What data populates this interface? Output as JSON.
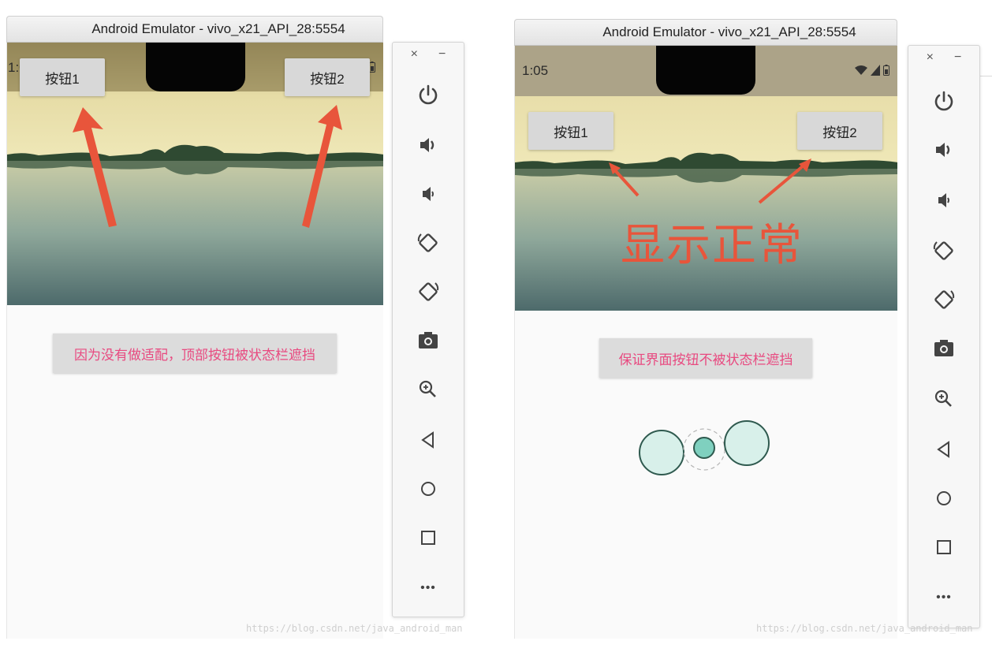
{
  "left": {
    "title": "Android Emulator - vivo_x21_API_28:5554",
    "status_time": "1:04",
    "button1": "按钮1",
    "button2": "按钮2",
    "info": "因为没有做适配，顶部按钮被状态栏遮挡",
    "watermark": "https://blog.csdn.net/java_android_man"
  },
  "right": {
    "title": "Android Emulator - vivo_x21_API_28:5554",
    "status_time": "1:05",
    "button1": "按钮1",
    "button2": "按钮2",
    "annotation": "显示正常",
    "info": "保证界面按钮不被状态栏遮挡",
    "watermark": "https://blog.csdn.net/java_android_man"
  },
  "toolbar": {
    "close": "×",
    "minimize": "−",
    "more": "•••"
  },
  "colors": {
    "arrow": "#e8553b",
    "info_text": "#e84a80",
    "loading_fill": "#d8f0ea",
    "loading_stroke": "#2f5a4f",
    "loading_center": "#7fd0bf"
  }
}
